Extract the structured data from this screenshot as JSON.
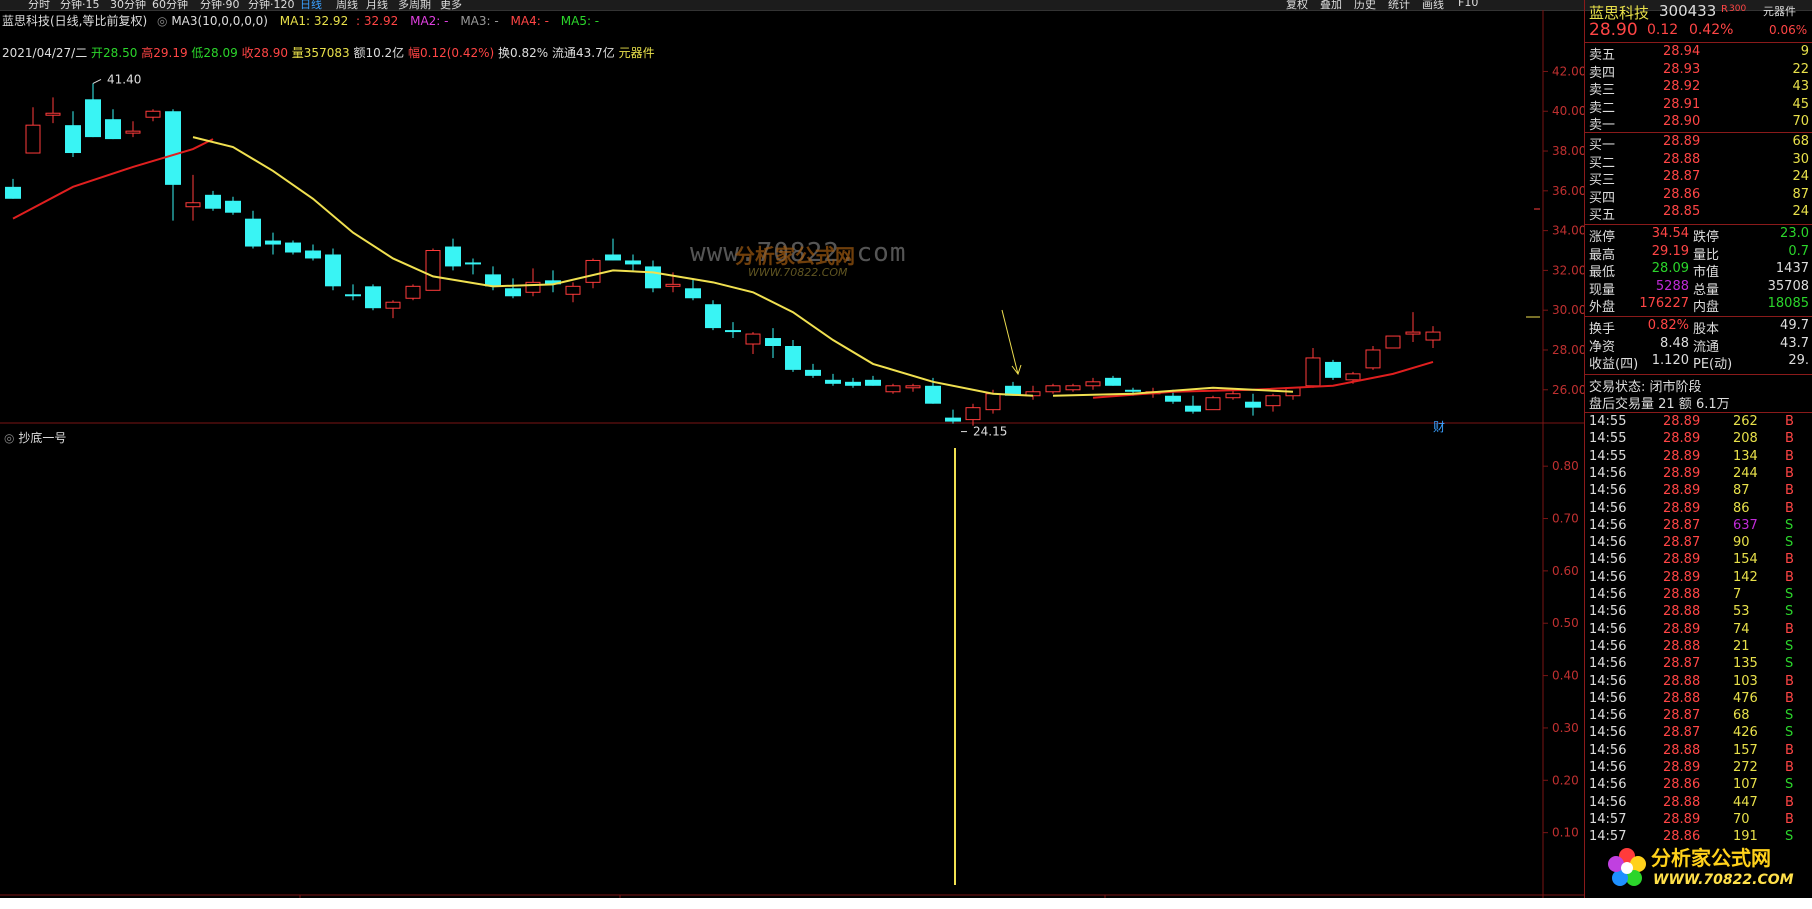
{
  "toolbar": {
    "periods": [
      "分时",
      "分钟·15",
      "30分钟",
      "60分钟",
      "分钟·90",
      "分钟·120",
      "日线",
      "周线",
      "月线",
      "多周期",
      "更多"
    ],
    "active_period": "日线",
    "right_tools": [
      "复权",
      "叠加",
      "历史",
      "统计",
      "画线",
      "F10"
    ]
  },
  "chart_header": {
    "stock_label": "蓝思科技(日线,等比前复权)",
    "ma_label": "MA3(10,0,0,0,0)",
    "ma1": "MA1: 32.92",
    "ma1_val": ": 32.92",
    "ma2": "MA2: -",
    "ma3": "MA3: -",
    "ma4": "MA4: -",
    "ma5": "MA5: -"
  },
  "info_line": {
    "date": "2021/04/27/二",
    "open": "开28.50",
    "high": "高29.19",
    "low": "低28.09",
    "close": "收28.90",
    "volume": "量357083",
    "amount": "额10.2亿",
    "range": "幅0.12(0.42%)",
    "turnover": "换0.82%",
    "float": "流通43.7亿",
    "sector": "元器件"
  },
  "price_annotations": {
    "high": "41.40",
    "low": "24.15",
    "fin_badge": "财"
  },
  "price_axis": [
    "42.00",
    "40.00",
    "38.00",
    "36.00",
    "34.00",
    "32.00",
    "30.00",
    "28.00",
    "26.00"
  ],
  "indicator": {
    "name": "抄底一号",
    "axis": [
      "0.80",
      "0.70",
      "0.60",
      "0.50",
      "0.40",
      "0.30",
      "0.20",
      "0.10"
    ]
  },
  "watermark": {
    "url": "www.70822.com",
    "brand": "分析家公式网",
    "brand_url": "WWW.70822.COM"
  },
  "panel": {
    "name": "蓝思科技",
    "code": "300433",
    "r_tag": "R",
    "index_tag": "300",
    "sector": "元器件",
    "price": "28.90",
    "change": "0.12",
    "pct": "0.42%",
    "weibi": "0.06%",
    "asks": [
      {
        "label": "卖五",
        "price": "28.94",
        "vol": "9"
      },
      {
        "label": "卖四",
        "price": "28.93",
        "vol": "22"
      },
      {
        "label": "卖三",
        "price": "28.92",
        "vol": "43"
      },
      {
        "label": "卖二",
        "price": "28.91",
        "vol": "45"
      },
      {
        "label": "卖一",
        "price": "28.90",
        "vol": "70"
      }
    ],
    "bids": [
      {
        "label": "买一",
        "price": "28.89",
        "vol": "68"
      },
      {
        "label": "买二",
        "price": "28.88",
        "vol": "30"
      },
      {
        "label": "买三",
        "price": "28.87",
        "vol": "24"
      },
      {
        "label": "买四",
        "price": "28.86",
        "vol": "87"
      },
      {
        "label": "买五",
        "price": "28.85",
        "vol": "24"
      }
    ],
    "stats1": [
      {
        "l1": "涨停",
        "v1": "34.54",
        "l2": "跌停",
        "v2": "23.0"
      },
      {
        "l1": "最高",
        "v1": "29.19",
        "l2": "量比",
        "v2": "0.7"
      },
      {
        "l1": "最低",
        "v1": "28.09",
        "l2": "市值",
        "v2": "1437"
      },
      {
        "l1": "现量",
        "v1": "5288",
        "l2": "总量",
        "v2": "35708"
      },
      {
        "l1": "外盘",
        "v1": "176227",
        "l2": "内盘",
        "v2": "18085"
      }
    ],
    "stats2": [
      {
        "l1": "换手",
        "v1": "0.82%",
        "l2": "股本",
        "v2": "49.7"
      },
      {
        "l1": "净资",
        "v1": "8.48",
        "l2": "流通",
        "v2": "43.7"
      },
      {
        "l1": "收益(四)",
        "v1": "1.120",
        "l2": "PE(动)",
        "v2": "29."
      }
    ],
    "status": "交易状态: 闭市阶段",
    "after_hours": "盘后交易量 21 额 6.1万",
    "ticks": [
      {
        "t": "14:55",
        "p": "28.89",
        "v": "262",
        "s": "B"
      },
      {
        "t": "14:55",
        "p": "28.89",
        "v": "208",
        "s": "B"
      },
      {
        "t": "14:55",
        "p": "28.89",
        "v": "134",
        "s": "B"
      },
      {
        "t": "14:56",
        "p": "28.89",
        "v": "244",
        "s": "B"
      },
      {
        "t": "14:56",
        "p": "28.89",
        "v": "87",
        "s": "B"
      },
      {
        "t": "14:56",
        "p": "28.89",
        "v": "86",
        "s": "B"
      },
      {
        "t": "14:56",
        "p": "28.87",
        "v": "637",
        "s": "S"
      },
      {
        "t": "14:56",
        "p": "28.87",
        "v": "90",
        "s": "S"
      },
      {
        "t": "14:56",
        "p": "28.89",
        "v": "154",
        "s": "B"
      },
      {
        "t": "14:56",
        "p": "28.89",
        "v": "142",
        "s": "B"
      },
      {
        "t": "14:56",
        "p": "28.88",
        "v": "7",
        "s": "S"
      },
      {
        "t": "14:56",
        "p": "28.88",
        "v": "53",
        "s": "S"
      },
      {
        "t": "14:56",
        "p": "28.89",
        "v": "74",
        "s": "B"
      },
      {
        "t": "14:56",
        "p": "28.88",
        "v": "21",
        "s": "S"
      },
      {
        "t": "14:56",
        "p": "28.87",
        "v": "135",
        "s": "S"
      },
      {
        "t": "14:56",
        "p": "28.88",
        "v": "103",
        "s": "B"
      },
      {
        "t": "14:56",
        "p": "28.88",
        "v": "476",
        "s": "B"
      },
      {
        "t": "14:56",
        "p": "28.87",
        "v": "68",
        "s": "S"
      },
      {
        "t": "14:56",
        "p": "28.87",
        "v": "426",
        "s": "S"
      },
      {
        "t": "14:56",
        "p": "28.88",
        "v": "157",
        "s": "B"
      },
      {
        "t": "14:56",
        "p": "28.89",
        "v": "272",
        "s": "B"
      },
      {
        "t": "14:56",
        "p": "28.86",
        "v": "107",
        "s": "S"
      },
      {
        "t": "14:56",
        "p": "28.88",
        "v": "447",
        "s": "B"
      },
      {
        "t": "14:57",
        "p": "28.89",
        "v": "70",
        "s": "B"
      },
      {
        "t": "14:57",
        "p": "28.86",
        "v": "191",
        "s": "S"
      }
    ]
  },
  "chart_data": {
    "type": "candlestick",
    "ylim": [
      24,
      43
    ],
    "candles": [
      [
        36.2,
        36.6,
        35.6,
        35.6
      ],
      [
        37.9,
        40.2,
        37.9,
        39.3
      ],
      [
        39.8,
        40.7,
        39.4,
        39.9
      ],
      [
        39.3,
        40.0,
        37.7,
        37.9
      ],
      [
        40.6,
        41.4,
        38.7,
        38.7
      ],
      [
        39.6,
        40.1,
        38.6,
        38.6
      ],
      [
        38.9,
        39.5,
        38.7,
        39.0
      ],
      [
        39.7,
        40.1,
        39.5,
        40.0
      ],
      [
        40.0,
        40.1,
        34.5,
        36.3
      ],
      [
        35.2,
        36.8,
        34.5,
        35.4
      ],
      [
        35.8,
        36.0,
        35.0,
        35.1
      ],
      [
        35.5,
        35.7,
        34.8,
        34.9
      ],
      [
        34.6,
        35.0,
        33.1,
        33.2
      ],
      [
        33.5,
        33.9,
        32.8,
        33.3
      ],
      [
        33.4,
        33.5,
        32.8,
        32.9
      ],
      [
        33.0,
        33.3,
        32.5,
        32.6
      ],
      [
        32.8,
        33.1,
        31.0,
        31.2
      ],
      [
        30.8,
        31.3,
        30.5,
        30.7
      ],
      [
        31.2,
        31.3,
        30.0,
        30.1
      ],
      [
        30.1,
        30.5,
        29.6,
        30.4
      ],
      [
        30.6,
        31.3,
        30.5,
        31.2
      ],
      [
        31.0,
        33.1,
        31.0,
        33.0
      ],
      [
        33.2,
        33.6,
        32.0,
        32.2
      ],
      [
        32.4,
        32.6,
        31.8,
        32.3
      ],
      [
        31.8,
        32.2,
        31.0,
        31.2
      ],
      [
        31.1,
        31.6,
        30.6,
        30.7
      ],
      [
        30.9,
        32.1,
        30.7,
        31.4
      ],
      [
        31.5,
        32.0,
        30.9,
        31.3
      ],
      [
        30.8,
        31.4,
        30.4,
        31.2
      ],
      [
        31.4,
        32.6,
        31.1,
        32.5
      ],
      [
        32.8,
        33.6,
        32.5,
        32.5
      ],
      [
        32.5,
        32.8,
        32.0,
        32.3
      ],
      [
        32.2,
        32.5,
        30.9,
        31.1
      ],
      [
        31.2,
        31.9,
        30.9,
        31.3
      ],
      [
        31.1,
        31.6,
        30.5,
        30.6
      ],
      [
        30.3,
        30.5,
        29.0,
        29.1
      ],
      [
        29.0,
        29.4,
        28.6,
        28.9
      ],
      [
        28.3,
        28.9,
        27.8,
        28.8
      ],
      [
        28.6,
        29.1,
        27.6,
        28.2
      ],
      [
        28.2,
        28.5,
        26.9,
        27.0
      ],
      [
        27.0,
        27.3,
        26.6,
        26.7
      ],
      [
        26.5,
        26.8,
        26.2,
        26.3
      ],
      [
        26.4,
        26.6,
        26.1,
        26.2
      ],
      [
        26.5,
        26.7,
        26.2,
        26.2
      ],
      [
        25.9,
        26.3,
        25.8,
        26.2
      ],
      [
        26.1,
        26.3,
        25.9,
        26.2
      ],
      [
        26.2,
        26.6,
        25.3,
        25.3
      ],
      [
        24.6,
        25.0,
        24.3,
        24.4
      ],
      [
        24.5,
        25.3,
        24.2,
        25.1
      ],
      [
        25.0,
        26.0,
        24.8,
        25.8
      ],
      [
        26.2,
        26.4,
        25.7,
        25.7
      ],
      [
        25.7,
        26.2,
        25.5,
        25.9
      ],
      [
        25.9,
        26.3,
        25.8,
        26.2
      ],
      [
        26.0,
        26.3,
        25.9,
        26.2
      ],
      [
        26.2,
        26.6,
        26.0,
        26.4
      ],
      [
        26.6,
        26.7,
        26.2,
        26.2
      ],
      [
        26.0,
        26.1,
        25.7,
        25.9
      ],
      [
        25.8,
        26.1,
        25.6,
        25.9
      ],
      [
        25.7,
        26.0,
        25.3,
        25.4
      ],
      [
        25.2,
        25.7,
        24.8,
        24.9
      ],
      [
        25.0,
        25.7,
        25.0,
        25.6
      ],
      [
        25.6,
        26.0,
        25.5,
        25.8
      ],
      [
        25.4,
        25.8,
        24.7,
        25.1
      ],
      [
        25.2,
        25.8,
        24.9,
        25.7
      ],
      [
        25.7,
        26.1,
        25.5,
        26.1
      ],
      [
        26.2,
        28.1,
        26.1,
        27.6
      ],
      [
        27.4,
        27.5,
        26.5,
        26.6
      ],
      [
        26.5,
        26.9,
        26.3,
        26.8
      ],
      [
        27.1,
        28.2,
        27.0,
        28.0
      ],
      [
        28.1,
        28.7,
        28.1,
        28.7
      ],
      [
        28.8,
        29.9,
        28.4,
        28.9
      ],
      [
        28.5,
        29.2,
        28.1,
        28.9
      ]
    ],
    "ma_long": [
      [
        0,
        34.6
      ],
      [
        3,
        36.2
      ],
      [
        6,
        37.2
      ],
      [
        9,
        38.1
      ],
      [
        10,
        38.6
      ]
    ],
    "ma_long2": [
      [
        54,
        25.6
      ],
      [
        58,
        25.9
      ],
      [
        62,
        26.0
      ],
      [
        66,
        26.2
      ],
      [
        69,
        26.8
      ],
      [
        71,
        27.4
      ]
    ],
    "ma_short": [
      [
        9,
        38.7
      ],
      [
        11,
        38.2
      ],
      [
        13,
        37.0
      ],
      [
        15,
        35.6
      ],
      [
        17,
        33.9
      ],
      [
        19,
        32.6
      ],
      [
        21,
        31.7
      ],
      [
        24,
        31.2
      ],
      [
        27,
        31.3
      ],
      [
        30,
        32.0
      ],
      [
        32,
        31.9
      ],
      [
        35,
        31.4
      ],
      [
        37,
        30.9
      ],
      [
        39,
        29.9
      ],
      [
        41,
        28.5
      ],
      [
        43,
        27.3
      ],
      [
        46,
        26.4
      ],
      [
        49,
        25.8
      ],
      [
        51,
        25.7
      ]
    ],
    "ma_short2": [
      [
        52,
        25.7
      ],
      [
        56,
        25.8
      ],
      [
        60,
        26.1
      ],
      [
        64,
        25.9
      ]
    ],
    "signal_index": 47
  }
}
